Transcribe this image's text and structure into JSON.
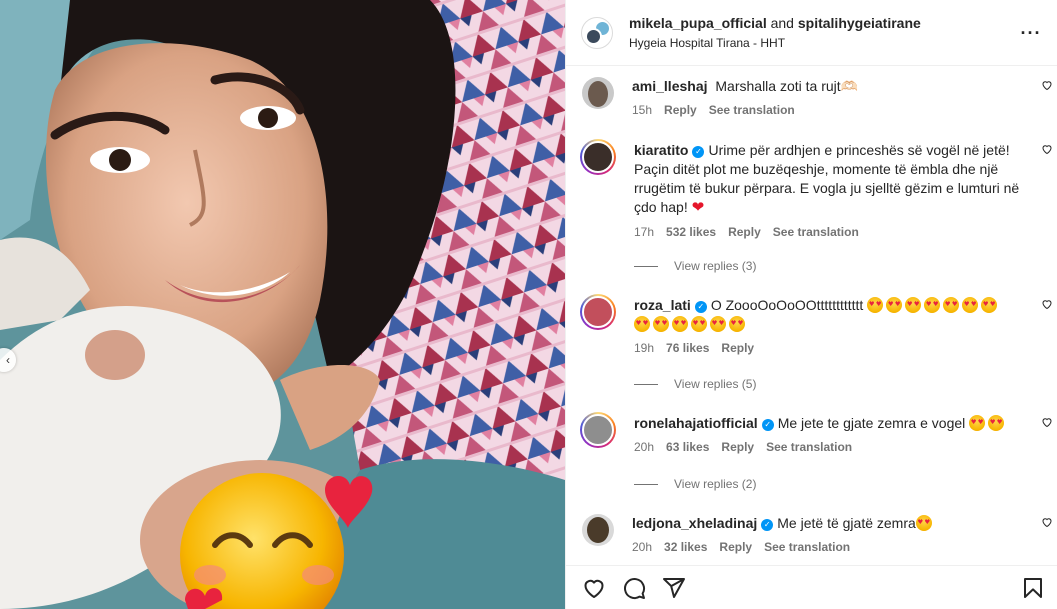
{
  "header": {
    "username": "mikela_pupa_official",
    "connector": "and",
    "collaborator": "spitalihygeiatirane",
    "location": "Hygeia Hospital Tirana - HHT"
  },
  "comments": [
    {
      "username": "ami_lleshaj",
      "verified": false,
      "text": "Marshalla zoti ta rujt🫶🏻",
      "time": "15h",
      "likes": "",
      "reply": "Reply",
      "translation": "See translation",
      "view_replies": ""
    },
    {
      "username": "kiaratito",
      "verified": true,
      "text": "Urime për ardhjen e princeshës së vogël në jetë! Paçin ditët plot me buzëqeshje, momente të ëmbla dhe një rrugëtim të bukur përpara. E vogla ju sjelltë gëzim e lumturi në çdo hap! ",
      "time": "17h",
      "likes": "532 likes",
      "reply": "Reply",
      "translation": "See translation",
      "view_replies": "View replies (3)"
    },
    {
      "username": "roza_lati",
      "verified": true,
      "text": "O ZoooOoOoOOtttttttttttt",
      "time": "19h",
      "likes": "76 likes",
      "reply": "Reply",
      "translation": "",
      "view_replies": "View replies (5)"
    },
    {
      "username": "ronelahajatiofficial",
      "verified": true,
      "text": "Me jete te gjate zemra e vogel",
      "time": "20h",
      "likes": "63 likes",
      "reply": "Reply",
      "translation": "See translation",
      "view_replies": "View replies (2)"
    },
    {
      "username": "ledjona_xheladinaj",
      "verified": true,
      "text": "Me jetë të gjatë zemra",
      "time": "20h",
      "likes": "32 likes",
      "reply": "Reply",
      "translation": "See translation",
      "view_replies": ""
    }
  ],
  "icons": {
    "like": "heart-icon",
    "comment": "comment-icon",
    "share": "share-icon",
    "save": "bookmark-icon",
    "more": "more-options-icon",
    "verified": "verified-badge-icon",
    "photo_sticker": "smiling-face-with-hearts-emoji"
  },
  "colors": {
    "verified_blue": "#0095f6",
    "muted_text": "#737373",
    "border": "#efefef",
    "heart_red": "#e5162b"
  }
}
